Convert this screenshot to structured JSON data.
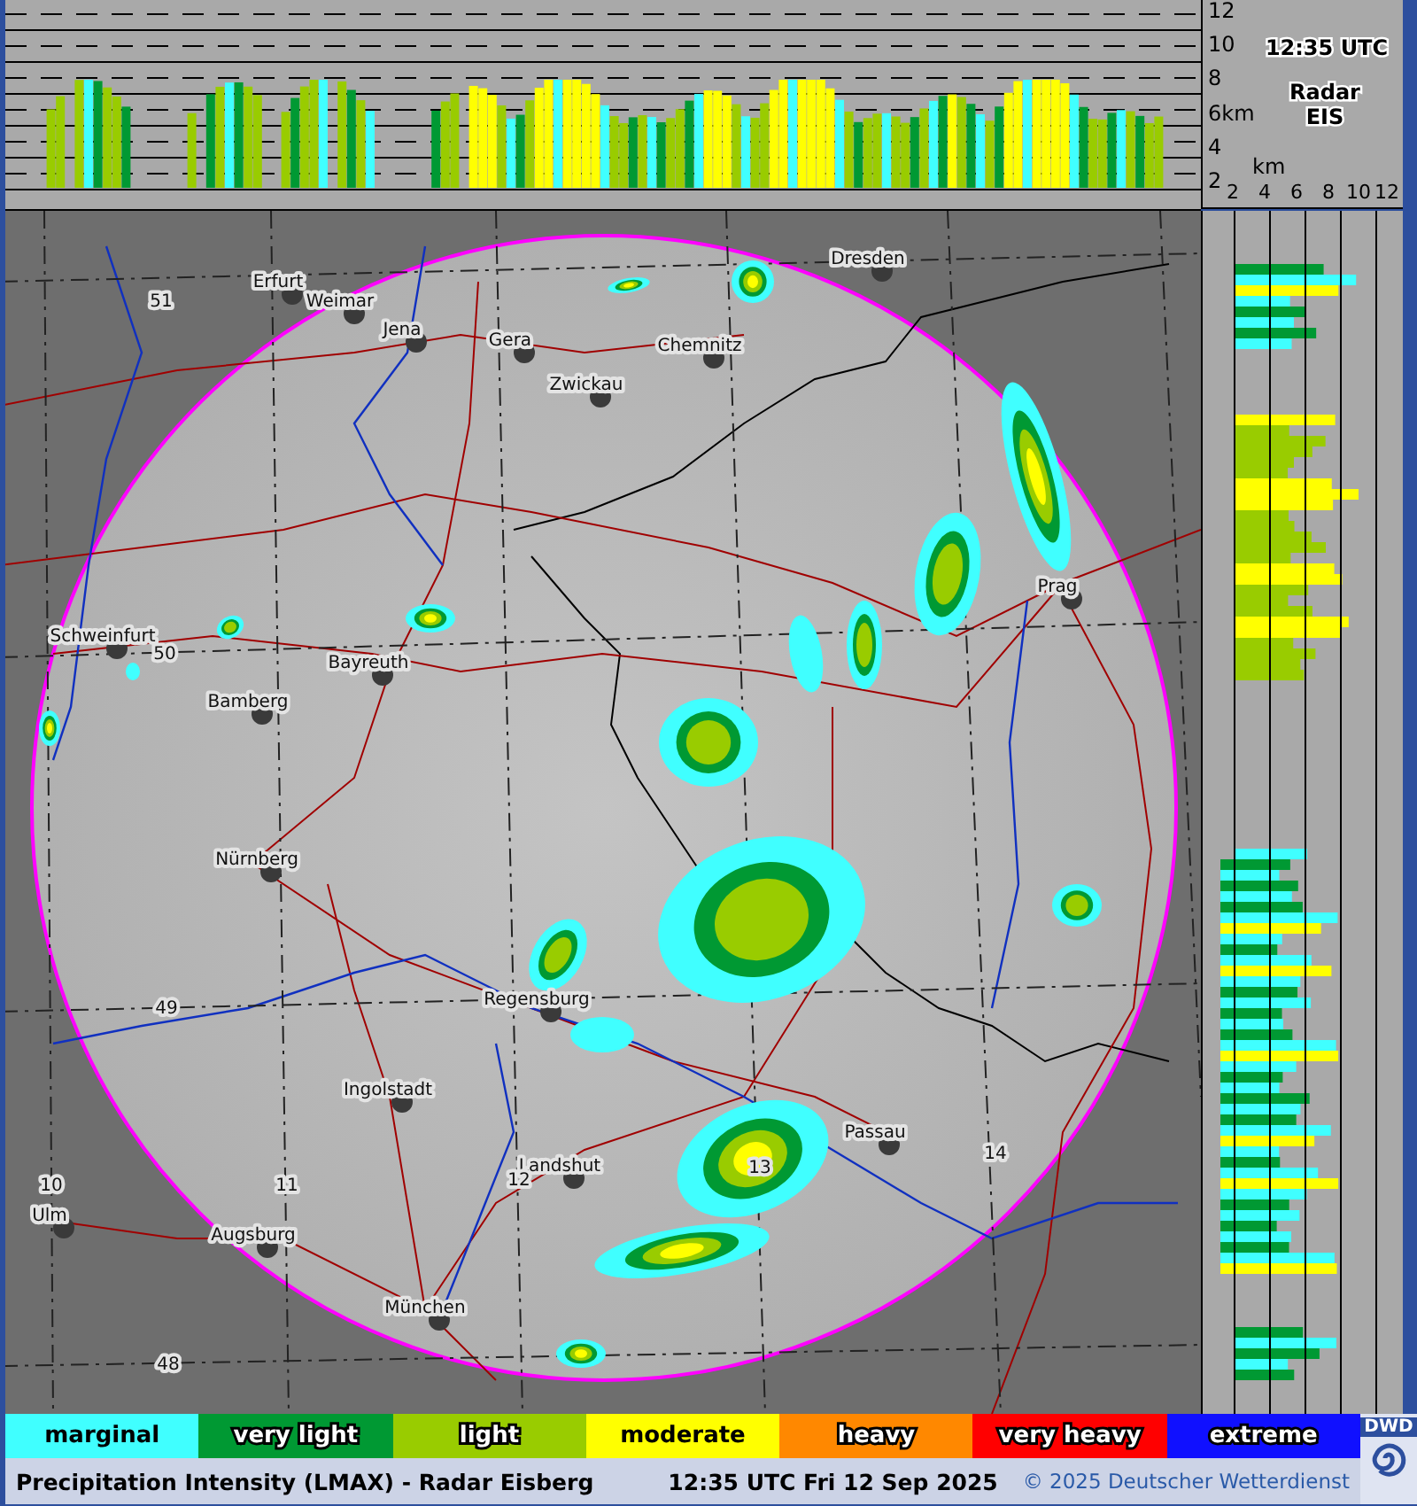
{
  "top_panel": {
    "height_axis": [
      "12",
      "10",
      "8",
      "6km",
      "4",
      "2"
    ],
    "time": "12:35 UTC",
    "radar_label": "Radar",
    "station": "EIS",
    "distance_unit": "km",
    "distance_axis": [
      "2",
      "4",
      "6",
      "8",
      "10",
      "12"
    ]
  },
  "map": {
    "cities": [
      "Erfurt",
      "Weimar",
      "Jena",
      "Gera",
      "Chemnitz",
      "Zwickau",
      "Dresden",
      "Prag",
      "Schweinfurt",
      "Bayreuth",
      "Bamberg",
      "Nürnberg",
      "Regensburg",
      "Ingolstadt",
      "Landshut",
      "Passau",
      "Augsburg",
      "München",
      "Ulm"
    ],
    "latitude_labels": [
      "51",
      "50",
      "49",
      "48"
    ],
    "longitude_labels": [
      "10",
      "11",
      "12",
      "13",
      "14"
    ]
  },
  "legend": [
    {
      "label": "marginal",
      "color": "#40ffff"
    },
    {
      "label": "very light",
      "color": "#009933"
    },
    {
      "label": "light",
      "color": "#99cc00"
    },
    {
      "label": "moderate",
      "color": "#ffff00"
    },
    {
      "label": "heavy",
      "color": "#ff8800"
    },
    {
      "label": "very heavy",
      "color": "#ff0000"
    },
    {
      "label": "extreme",
      "color": "#1010ff"
    }
  ],
  "logo": "DWD",
  "footer": {
    "title": "Precipitation Intensity (LMAX) - Radar Eisberg",
    "timestamp": "12:35 UTC Fri 12 Sep 2025",
    "copyright": "© 2025 Deutscher Wetterdienst"
  }
}
